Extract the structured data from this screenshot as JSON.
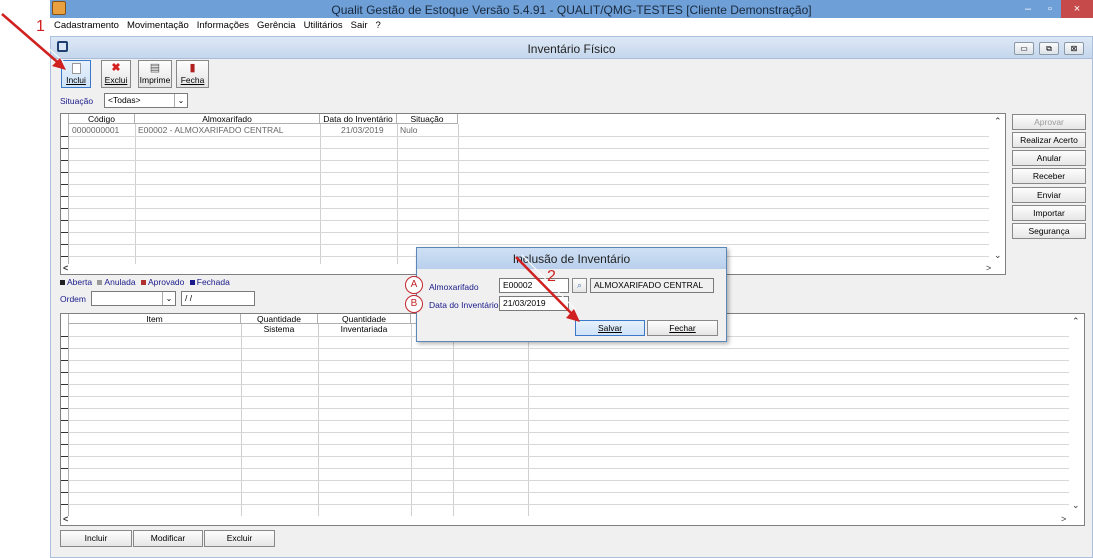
{
  "app": {
    "title": "Qualit Gestão de Estoque Versão 5.4.91 - QUALIT/QMG-TESTES [Cliente Demonstração]",
    "window_controls": [
      "–",
      "▫",
      "×"
    ]
  },
  "menu": [
    "Cadastramento",
    "Movimentação",
    "Informações",
    "Gerência",
    "Utilitários",
    "Sair",
    "?"
  ],
  "child": {
    "title": "Inventário Físico",
    "controls": [
      "▭",
      "⧉",
      "⊠"
    ]
  },
  "toolbar": {
    "incluir": "Inclui",
    "excluir": "Exclui",
    "imprimir": "Imprime",
    "fechar": "Fecha"
  },
  "filter": {
    "situacao_label": "Situação",
    "situacao_value": "<Todas>"
  },
  "top_grid": {
    "columns": [
      "Código",
      "Almoxarifado",
      "Data do Inventário",
      "Situação"
    ],
    "rows": [
      [
        "0000000001",
        "E00002 - ALMOXARIFADO CENTRAL",
        "21/03/2019",
        "Nulo"
      ]
    ]
  },
  "side_buttons": [
    "Aprovar",
    "Realizar Acerto",
    "Anular",
    "Receber",
    "Enviar",
    "Importar",
    "Segurança"
  ],
  "legend": {
    "aberta": "Aberta",
    "anulada": "Anulada",
    "aprovado": "Aprovado",
    "fechada": "Fechada"
  },
  "ordem": {
    "label": "Ordem",
    "value": "",
    "date": " / /"
  },
  "bottom_grid": {
    "columns": [
      "Item",
      "Quantidade Sistema",
      "Quantidade Inventariada"
    ]
  },
  "bottom_buttons": {
    "incluir": "Incluir",
    "modificar": "Modificar",
    "excluir": "Excluir"
  },
  "dialog": {
    "title": "Inclusão de Inventário",
    "almox_label": "Almoxarifado",
    "almox_code": "E00002",
    "almox_name": "ALMOXARIFADO CENTRAL",
    "data_label": "Data do Inventário",
    "data_value": "21/03/2019",
    "salvar": "Salvar",
    "fechar": "Fechar"
  },
  "annotations": {
    "step1": "1",
    "step2": "2",
    "markA": "A",
    "markB": "B"
  },
  "colors": {
    "accent": "#c0242a",
    "titlebar": "#6e9fd6"
  }
}
